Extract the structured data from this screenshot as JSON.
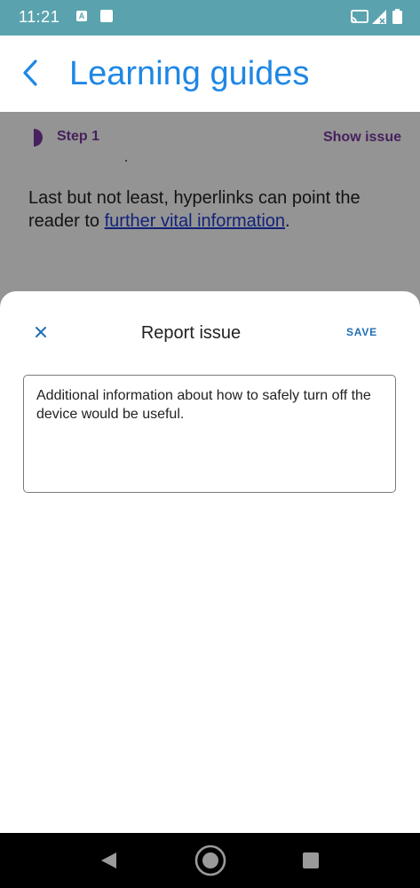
{
  "status_bar": {
    "time": "11:21",
    "notification_icon_letter": "A",
    "icons": [
      "a-notification-icon",
      "square-notification-icon",
      "cast-icon",
      "signal-icon",
      "battery-icon"
    ]
  },
  "app_bar": {
    "title": "Learning guides",
    "back_icon": "chevron-left-icon",
    "title_color": "#1e87e5"
  },
  "content": {
    "step_label": "Step 1",
    "show_issue_label": "Show issue",
    "body_text_before": "Last but not least, hyperlinks can point the reader to ",
    "body_link": "further vital information",
    "body_text_after": ".",
    "accent_color": "#7b3aa0",
    "link_color": "#1f3bd1"
  },
  "report_sheet": {
    "title": "Report issue",
    "save_label": "SAVE",
    "close_icon": "close-icon",
    "textarea_value": "Additional information about how to safely turn off the device would be useful."
  },
  "nav_bar": {
    "icons": [
      "nav-back-icon",
      "nav-home-icon",
      "nav-recents-icon"
    ]
  }
}
